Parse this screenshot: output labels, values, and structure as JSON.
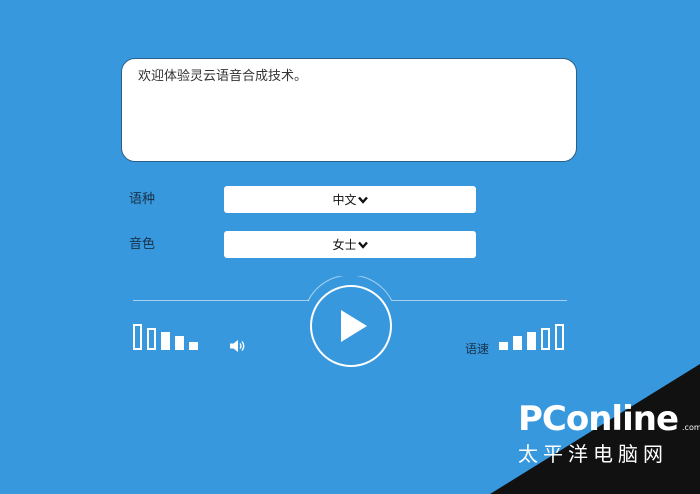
{
  "input": {
    "text": "欢迎体验灵云语音合成技术。"
  },
  "language": {
    "label": "语种",
    "selected": "中文"
  },
  "voice": {
    "label": "音色",
    "selected": "女士"
  },
  "player": {
    "state": "paused"
  },
  "volume": {
    "bars": 5,
    "filled": 3
  },
  "speed": {
    "label": "语速",
    "bars": 5,
    "filled": 3
  },
  "watermark": {
    "brand": "PConline",
    "domain": ".com.cn",
    "subtitle": "太平洋电脑网"
  },
  "colors": {
    "background": "#3898dd",
    "text_dark": "#17324a"
  }
}
